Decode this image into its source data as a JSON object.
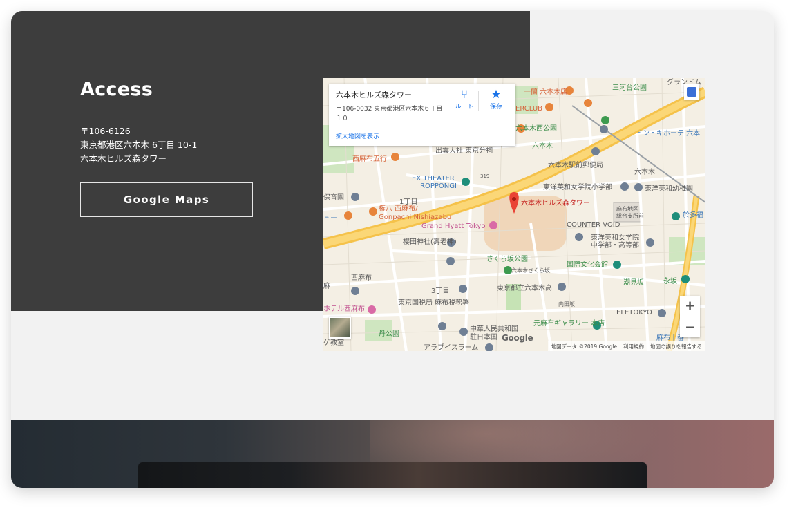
{
  "access": {
    "title": "Access",
    "postal": "〒106-6126",
    "address": "東京都港区六本木 6丁目 10-1",
    "building": "六本木ヒルズ森タワー",
    "button_label": "Google Maps"
  },
  "map": {
    "card": {
      "title": "六本木ヒルズ森タワー",
      "address": "〒106-0032 東京都港区六本木６丁目１０",
      "directions_label": "ルート",
      "save_label": "保存",
      "larger_map_link": "拡大地図を表示",
      "directions_icon": "directions-icon",
      "save_icon": "star-icon"
    },
    "pin_label": "六本木ヒルズ森タワー",
    "labels": {
      "l1": "三河台公園",
      "l2": "グランドム",
      "l3": "一蘭 六本木店",
      "l4": "ERCLUB",
      "l5": "六本木西公園",
      "l6": "ドン・キホーテ 六本",
      "l7": "出雲大社 東京分祠",
      "l8": "六本木",
      "l9": "西麻布五行",
      "l10": "六本木駅前郵便局",
      "l11": "六本木",
      "l12": "EX THEATER",
      "l13": "ROPPONGI",
      "l14": "東洋英和女学院小学部",
      "l15": "東洋英和幼稚園",
      "l16": "保育園",
      "l17": "1丁目",
      "l18": "権八 西麻布/",
      "l19": "Gonpachi Nishiazabu",
      "l20": "麻布地区",
      "l21": "総合支所前",
      "l22": "於多福",
      "l23": "Grand Hyatt Tokyo",
      "l24": "COUNTER VOID",
      "l25": "櫻田神社(壽老神)",
      "l26": "東洋英和女学院",
      "l27": "中学部・高等部",
      "l28": "さくら坂公園",
      "l29": "六本木さくら坂",
      "l30": "国際文化会館",
      "l31": "西麻布",
      "l32": "3丁目",
      "l33": "東京都立六本木高",
      "l34": "潮見坂",
      "l35": "永坂",
      "l36": "ホテル西麻布",
      "l37": "東京国税局 麻布税務署",
      "l38": "内田坂",
      "l39": "ELETOKYO",
      "l40": "中華人民共和国",
      "l41": "駐日本国",
      "l42": "元麻布ギャラリー 本店",
      "l43": "麻布十番",
      "l44": "ゲ教室",
      "l45": "丹公園",
      "l46": "アラブイスラーム",
      "l47": "ュー",
      "l48": "麻",
      "l49": "319"
    },
    "google_logo": "Google",
    "footer_data": "地図データ ©2019 Google",
    "footer_terms": "利用規約",
    "footer_report": "地図の誤りを報告する",
    "zoom_in": "+",
    "zoom_out": "−",
    "icons": {
      "pin": "map-pin-icon",
      "pegman": "pegman-icon",
      "zoom_in": "zoom-in-icon",
      "zoom_out": "zoom-out-icon"
    },
    "colors": {
      "highway": "#f8c54c",
      "road": "#ffffff",
      "park": "#c6e3b5",
      "pin": "#e94335"
    }
  },
  "colors": {
    "dark_panel": "#3d3d3d",
    "page_bg": "#f2f2f2"
  }
}
